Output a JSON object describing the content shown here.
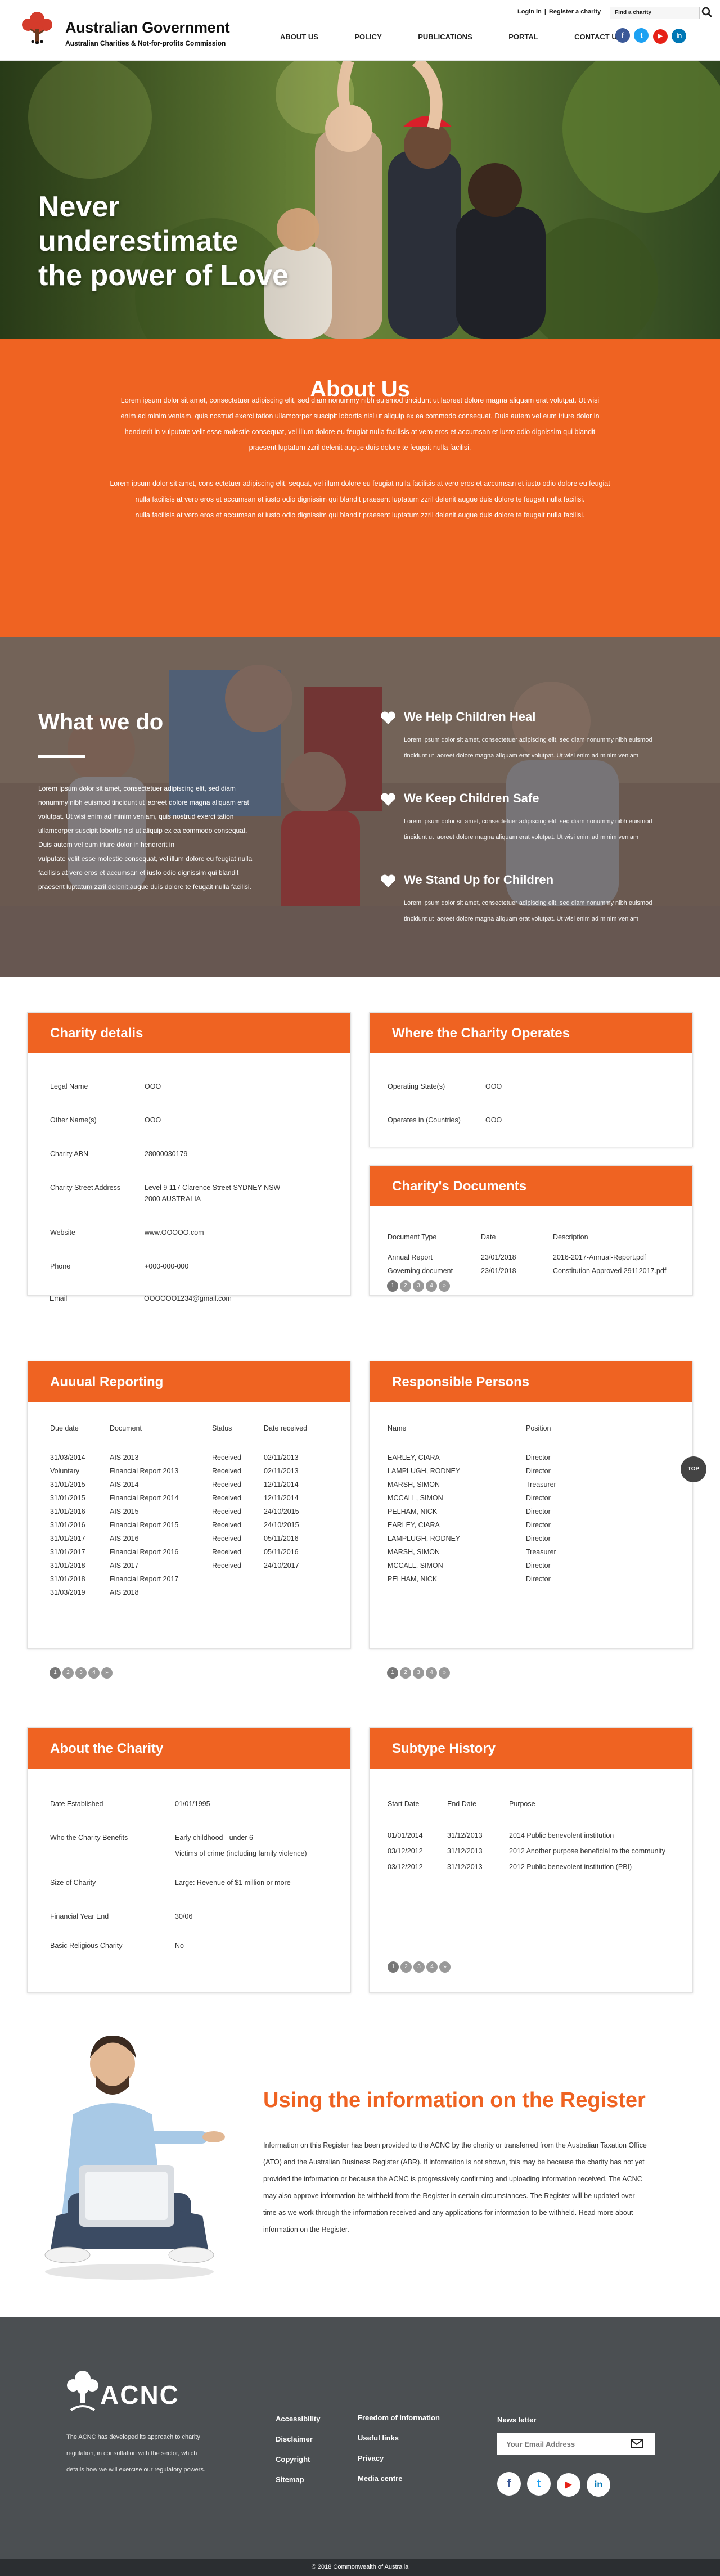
{
  "header": {
    "title": "Australian Government",
    "subtitle": "Australian Charities & Not-for-profits Commission",
    "login": "Login in",
    "register_link": "Register a charity",
    "search_placeholder": "Find a charity",
    "nav": [
      {
        "label": "ABOUT US"
      },
      {
        "label": "POLICY"
      },
      {
        "label": "PUBLICATIONS"
      },
      {
        "label": "PORTAL"
      },
      {
        "label": "CONTACT US"
      }
    ],
    "social": [
      "f",
      "t",
      "▶",
      "in"
    ]
  },
  "hero": {
    "title_lines": [
      "Never",
      "underestimate",
      "the power of Love"
    ]
  },
  "about": {
    "title": "About Us",
    "p1_lines": [
      "Lorem ipsum dolor sit amet, consectetuer adipiscing elit, sed diam nonummy nibh euismod tincidunt ut laoreet dolore magna aliquam erat volutpat. Ut wisi",
      "enim ad minim veniam, quis nostrud exerci tation ullamcorper suscipit lobortis nisl ut aliquip ex ea commodo consequat. Duis autem vel eum iriure dolor in",
      "hendrerit in vulputate velit esse molestie consequat, vel illum dolore eu feugiat nulla facilisis at vero eros et accumsan et iusto odio dignissim qui blandit",
      "praesent luptatum zzril delenit augue duis dolore te feugait nulla facilisi."
    ],
    "p2_lines": [
      "Lorem ipsum dolor sit amet, cons ectetuer adipiscing elit, sequat, vel illum dolore eu feugiat nulla facilisis at vero eros et accumsan et iusto odio dolore eu feugiat",
      "nulla facilisis at vero eros et accumsan et iusto odio dignissim qui blandit praesent luptatum zzril delenit augue duis dolore te feugait nulla facilisi.",
      "nulla facilisis at vero eros et accumsan et iusto odio dignissim qui blandit praesent luptatum zzril delenit augue duis dolore te feugait nulla facilisi."
    ]
  },
  "what_we_do": {
    "title": "What we do",
    "text_lines": [
      "Lorem ipsum dolor sit amet, consectetuer adipiscing elit, sed diam",
      "nonummy nibh euismod tincidunt ut laoreet dolore magna aliquam erat",
      "volutpat. Ut wisi enim ad minim veniam, quis nostrud exerci tation",
      "ullamcorper suscipit lobortis nisl ut aliquip ex ea commodo consequat.",
      "Duis autem vel eum iriure dolor in hendrerit in",
      "vulputate velit esse molestie consequat, vel illum dolore eu feugiat nulla",
      "facilisis at vero eros et accumsan et iusto odio dignissim qui blandit",
      "praesent luptatum zzril delenit augue duis dolore te feugait nulla facilisi."
    ],
    "items": [
      {
        "title": "We Help Children Heal",
        "lines": [
          "Lorem ipsum dolor sit amet, consectetuer adipiscing elit, sed diam nonummy nibh euismod",
          "tincidunt ut laoreet dolore magna aliquam erat volutpat. Ut wisi enim ad minim veniam"
        ]
      },
      {
        "title": "We Keep Children Safe",
        "lines": [
          "Lorem ipsum dolor sit amet, consectetuer adipiscing elit, sed diam nonummy nibh euismod",
          "tincidunt ut laoreet dolore magna aliquam erat volutpat. Ut wisi enim ad minim veniam"
        ]
      },
      {
        "title": "We Stand Up for Children",
        "lines": [
          "Lorem ipsum dolor sit amet, consectetuer adipiscing elit, sed diam nonummy nibh euismod",
          "tincidunt ut laoreet dolore magna aliquam erat volutpat. Ut wisi enim ad minim veniam"
        ]
      }
    ]
  },
  "charity_details": {
    "title": "Charity detalis",
    "rows": [
      {
        "label": "Legal Name",
        "value": "OOO"
      },
      {
        "label": "Other Name(s)",
        "value": "OOO"
      },
      {
        "label": "Charity ABN",
        "value": "28000030179"
      },
      {
        "label": "Charity Street Address",
        "value": "Level 9 117 Clarence Street SYDNEY NSW",
        "value2": "2000 AUSTRALIA"
      },
      {
        "label": "Website",
        "value": "www.OOOOO.com"
      },
      {
        "label": "Phone",
        "value": "+000-000-000"
      },
      {
        "label": "Email",
        "value": "OOOOOO1234@gmail.com"
      }
    ]
  },
  "operates": {
    "title": "Where the Charity Operates",
    "rows": [
      {
        "label": "Operating State(s)",
        "value": "OOO"
      },
      {
        "label": "Operates in (Countries)",
        "value": "OOO"
      }
    ]
  },
  "documents": {
    "title": "Charity's Documents",
    "headers": [
      "Document Type",
      "Date",
      "Description"
    ],
    "rows": [
      [
        "Annual Report",
        "23/01/2018",
        "2016-2017-Annual-Report.pdf"
      ],
      [
        "Governing document",
        "23/01/2018",
        "Constitution Approved 29112017.pdf"
      ]
    ],
    "pages": [
      "1",
      "2",
      "3",
      "4",
      "»"
    ]
  },
  "annual_reporting": {
    "title": "Auuual Reporting",
    "headers": [
      "Due date",
      "Document",
      "Status",
      "Date received"
    ],
    "rows": [
      [
        "31/03/2014",
        "AIS 2013",
        "Received",
        "02/11/2013"
      ],
      [
        "Voluntary",
        "Financial Report 2013",
        "Received",
        "02/11/2013"
      ],
      [
        "31/01/2015",
        "AIS 2014",
        "Received",
        "12/11/2014"
      ],
      [
        "31/01/2015",
        "Financial Report 2014",
        "Received",
        "12/11/2014"
      ],
      [
        "31/01/2016",
        "AIS 2015",
        "Received",
        "24/10/2015"
      ],
      [
        "31/01/2016",
        "Financial Report 2015",
        "Received",
        "24/10/2015"
      ],
      [
        "31/01/2017",
        "AIS 2016",
        "Received",
        "05/11/2016"
      ],
      [
        "31/01/2017",
        "Financial Report 2016",
        "Received",
        "05/11/2016"
      ],
      [
        "31/01/2018",
        "AIS 2017",
        "Received",
        "24/10/2017"
      ],
      [
        "31/01/2018",
        "Financial Report 2017",
        "",
        " "
      ],
      [
        "31/03/2019",
        "AIS 2018",
        "",
        ""
      ]
    ],
    "pages": [
      "1",
      "2",
      "3",
      "4",
      "»"
    ]
  },
  "responsible": {
    "title": "Responsible Persons",
    "headers": [
      "Name",
      "Position"
    ],
    "rows": [
      [
        "EARLEY, CIARA",
        "Director"
      ],
      [
        "LAMPLUGH, RODNEY",
        "Director"
      ],
      [
        "MARSH, SIMON",
        "Treasurer"
      ],
      [
        "MCCALL, SIMON",
        "Director"
      ],
      [
        "PELHAM, NICK",
        "Director"
      ],
      [
        "EARLEY, CIARA",
        "Director"
      ],
      [
        "LAMPLUGH, RODNEY",
        "Director"
      ],
      [
        "MARSH, SIMON",
        "Treasurer"
      ],
      [
        "MCCALL, SIMON",
        "Director"
      ],
      [
        "PELHAM, NICK",
        "Director"
      ]
    ],
    "pages": [
      "1",
      "2",
      "3",
      "4",
      "»"
    ]
  },
  "about_charity": {
    "title": "About the Charity",
    "rows": [
      {
        "label": "Date Established",
        "value": "01/01/1995"
      },
      {
        "label": "Who the Charity Benefits",
        "value": "Early childhood - under 6",
        "value2": "Victims of crime (including family violence)"
      },
      {
        "label": "Size of Charity",
        "value": "Large: Revenue of $1 million or more"
      },
      {
        "label": "Financial Year End",
        "value": "30/06"
      },
      {
        "label": "Basic Religious Charity",
        "value": "No"
      }
    ]
  },
  "subtype": {
    "title": "Subtype History",
    "headers": [
      "Start Date",
      "End Date",
      "Purpose"
    ],
    "rows": [
      [
        "01/01/2014",
        "31/12/2013",
        "2014 Public benevolent institution"
      ],
      [
        "03/12/2012",
        "31/12/2013",
        "2012 Another purpose beneficial to the community"
      ],
      [
        "03/12/2012",
        "31/12/2013",
        "2012 Public benevolent institution (PBI)"
      ]
    ],
    "pages": [
      "1",
      "2",
      "3",
      "4",
      "»"
    ]
  },
  "top_label": "TOP",
  "register": {
    "title": "Using the information on the Register",
    "lines": [
      "Information on this Register has been provided to the ACNC by the charity or transferred from the Australian Taxation Office",
      "(ATO) and the Australian Business Register (ABR). If information is not shown, this may be because the charity has not yet",
      "provided the information or because the ACNC is progressively confirming and uploading information received. The ACNC",
      "may also approve information be withheld from the Register in certain circumstances. The Register will be updated over",
      "time as we work through the information received and any applications for information to be withheld. Read more about",
      "information on the Register."
    ]
  },
  "footer": {
    "logo": "ACNC",
    "desc_lines": [
      "The ACNC has developed its approach to charity",
      "regulation, in consultation with the sector, which",
      "details how we will exercise our regulatory powers."
    ],
    "col1": [
      "Accessibility",
      "Disclaimer",
      "Copyright",
      "Sitemap"
    ],
    "col2": [
      "Freedom of information",
      "Useful links",
      "Privacy",
      "Media centre"
    ],
    "newsletter": "News letter",
    "email_placeholder": "Your Email Address",
    "social": [
      "f",
      "t",
      "▶",
      "in"
    ],
    "copyright": "© 2018 Commonwealth of Australia"
  },
  "colors": {
    "accent": "#ef6322",
    "footer": "#4b4f52",
    "facebook": "#3b5998",
    "twitter": "#1da1f2",
    "youtube": "#e62117",
    "linkedin": "#0077b5"
  }
}
